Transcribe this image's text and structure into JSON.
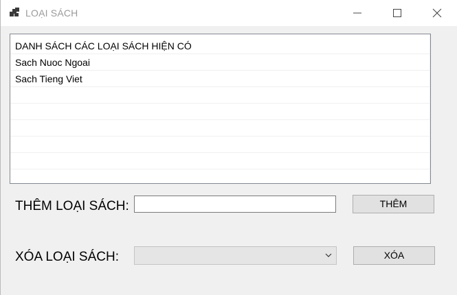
{
  "window": {
    "title": "LOẠI SÁCH",
    "icons": {
      "app": "app-windows-icon",
      "minimize": "minimize-icon",
      "maximize": "maximize-icon",
      "close": "close-icon"
    }
  },
  "list": {
    "rows": [
      "DANH SÁCH CÁC LOẠI SÁCH HIỆN CÓ",
      "Sach Nuoc Ngoai",
      "Sach Tieng Viet",
      "",
      "",
      "",
      "",
      "",
      ""
    ]
  },
  "add": {
    "label": "THÊM LOẠI SÁCH:",
    "input_value": "",
    "button_label": "THÊM"
  },
  "remove": {
    "label": "XÓA LOẠI SÁCH:",
    "selected": "",
    "button_label": "XÓA",
    "arrow_icon": "chevron-down-icon"
  }
}
